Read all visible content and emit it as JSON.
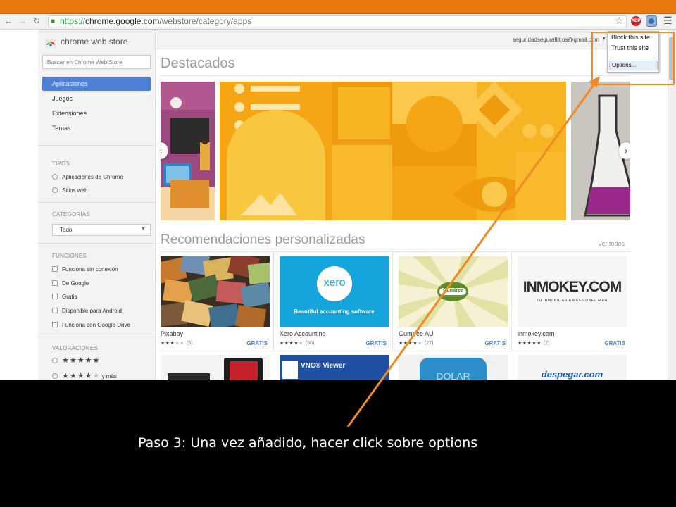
{
  "browser": {
    "url_scheme": "https://",
    "url_host": "chrome.google.com",
    "url_path": "/webstore/category/apps",
    "adblock_badge": "ABP"
  },
  "sidebar": {
    "store_name": "chrome web store",
    "search_placeholder": "Buscar en Chrome Web Store",
    "categories": [
      {
        "label": "Aplicaciones",
        "active": true
      },
      {
        "label": "Juegos",
        "active": false
      },
      {
        "label": "Extensiones",
        "active": false
      },
      {
        "label": "Temas",
        "active": false
      }
    ],
    "tipos": {
      "title": "TIPOS",
      "options": [
        "Aplicaciones de Chrome",
        "Sitios web"
      ]
    },
    "categorias": {
      "title": "CATEGORÍAS",
      "selected": "Todo"
    },
    "funciones": {
      "title": "FUNCIONES",
      "options": [
        "Funciona sin conexión",
        "De Google",
        "Gratis",
        "Disponible para Android",
        "Funciona con Google Drive"
      ]
    },
    "valoraciones": {
      "title": "VALORACIONES",
      "more_label": "y más"
    }
  },
  "header": {
    "user_email": "seguridadsegurafiltros@gmail.com"
  },
  "featured": {
    "title": "Destacados"
  },
  "recommendations": {
    "title": "Recomendaciones personalizadas",
    "see_all": "Ver todos",
    "apps": [
      {
        "name": "Pixabay",
        "stars": 3,
        "count": "(5)",
        "price": "GRATIS"
      },
      {
        "name": "Xero Accounting",
        "stars": 4,
        "count": "(50)",
        "price": "GRATIS",
        "thumb_brand": "xero",
        "thumb_tagline": "Beautiful accounting software"
      },
      {
        "name": "Gumtree AU",
        "stars": 4,
        "count": "(27)",
        "price": "GRATIS",
        "thumb_brand": "Gumtree"
      },
      {
        "name": "inmokey.com",
        "stars": 5,
        "count": "(2)",
        "price": "GRATIS",
        "thumb_brand": "INMOKEY.COM",
        "thumb_tagline": "TU INMOBILIARIA MÁS CONECTADA"
      }
    ],
    "second_row": [
      {
        "thumb_brand": ""
      },
      {
        "thumb_brand": "VNC® Viewer"
      },
      {
        "thumb_brand": "DOLAR"
      },
      {
        "thumb_brand": "despegar.com"
      }
    ]
  },
  "extension_menu": {
    "items": [
      "Block this site",
      "Trust this site"
    ],
    "options_label": "Options..."
  },
  "annotation": {
    "caption": "Paso 3: Una vez añadido, hacer click sobre options",
    "color": "#f08a24"
  },
  "colors": {
    "top_bar": "#e8790e",
    "active_category": "#4d80d6",
    "price_link": "#4d80d6"
  }
}
